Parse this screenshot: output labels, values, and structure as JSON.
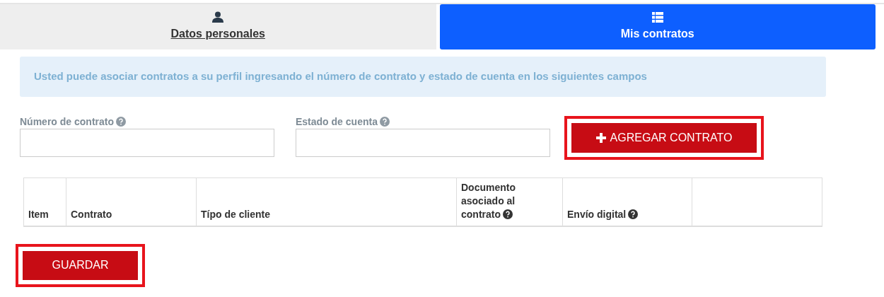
{
  "tabs": [
    {
      "label": "Datos personales",
      "selected": false
    },
    {
      "label": "Mis contratos",
      "selected": true
    }
  ],
  "info": "Usted puede asociar contratos a su perfil ingresando el número de contrato y estado de cuenta en los siguientes campos",
  "fields": [
    {
      "label": "Número de contrato",
      "help": true
    },
    {
      "label": "Estado de cuenta",
      "help": true
    }
  ],
  "add_button": {
    "label": "AGREGAR CONTRATO",
    "highlighted": true
  },
  "table": {
    "columns": [
      {
        "label": "Item",
        "help": false
      },
      {
        "label": "Contrato",
        "help": false
      },
      {
        "label": "Típo de cliente",
        "help": false
      },
      {
        "label": "Documento asociado al contrato",
        "help": true
      },
      {
        "label": "Envío digital",
        "help": true
      }
    ]
  },
  "save_button": {
    "label": "GUARDAR",
    "highlighted": true
  }
}
